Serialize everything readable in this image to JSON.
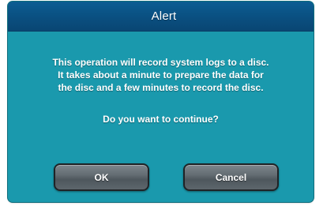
{
  "dialog": {
    "title": "Alert",
    "message_lines": [
      "This operation will record system logs to a disc.",
      "It takes about a minute to prepare the data for",
      "the disc and a few minutes to record the disc."
    ],
    "question": "Do you want to continue?"
  },
  "buttons": {
    "ok_label": "OK",
    "cancel_label": "Cancel"
  },
  "colors": {
    "dialog_background": "#1a99ad",
    "titlebar": "#0a4f80",
    "button": "#646d73",
    "text": "#ffffff"
  }
}
